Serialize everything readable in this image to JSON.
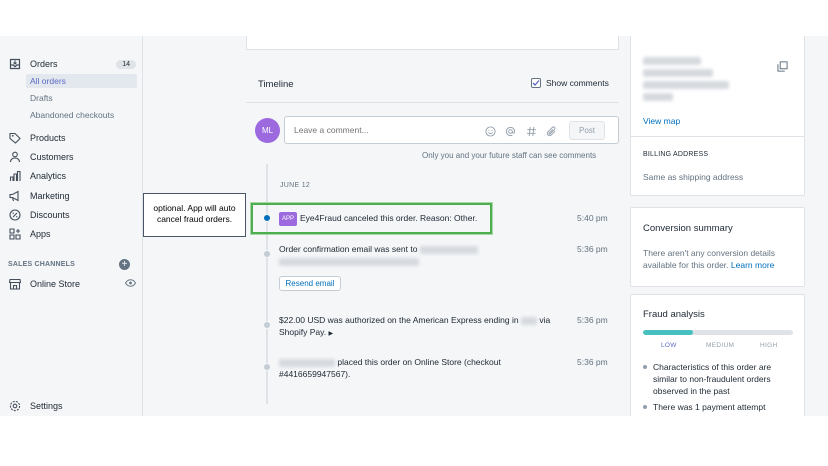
{
  "sidebar": {
    "orders": {
      "label": "Orders",
      "badge": "14",
      "icon": "orders-icon"
    },
    "sub_items": [
      {
        "label": "All orders",
        "active": true
      },
      {
        "label": "Drafts",
        "active": false
      },
      {
        "label": "Abandoned checkouts",
        "active": false
      }
    ],
    "items": [
      {
        "label": "Products",
        "icon": "tag-icon"
      },
      {
        "label": "Customers",
        "icon": "person-icon"
      },
      {
        "label": "Analytics",
        "icon": "bar-chart-icon"
      },
      {
        "label": "Marketing",
        "icon": "megaphone-icon"
      },
      {
        "label": "Discounts",
        "icon": "discount-icon"
      },
      {
        "label": "Apps",
        "icon": "apps-icon"
      }
    ],
    "sales_channels_label": "SALES CHANNELS",
    "online_store": {
      "label": "Online Store",
      "icon": "store-icon"
    },
    "settings": {
      "label": "Settings",
      "icon": "gear-icon"
    }
  },
  "timeline": {
    "title": "Timeline",
    "show_comments_label": "Show comments",
    "show_comments_checked": true,
    "avatar_initials": "ML",
    "comment_placeholder": "Leave a comment...",
    "post_label": "Post",
    "staff_note": "Only you and your future staff can see comments",
    "date_label": "JUNE 12",
    "events": [
      {
        "app_tag": "APP",
        "text": "Eye4Fraud canceled this order. Reason: Other.",
        "time": "5:40 pm"
      },
      {
        "text": "Order confirmation email was sent to",
        "time": "5:36 pm",
        "button": "Resend email"
      },
      {
        "text_a": "$22.00 USD was authorized on the American Express ending in",
        "text_b": "via",
        "text_c": "Shopify Pay.",
        "time": "5:36 pm"
      },
      {
        "text_a": "placed this order on Online Store (checkout",
        "text_b": "#4416659947567).",
        "time": "5:36 pm"
      }
    ]
  },
  "annotation": {
    "line1": "optional. App will auto",
    "line2": "cancel fraud orders."
  },
  "right": {
    "view_map": "View map",
    "billing_title": "BILLING ADDRESS",
    "billing_value": "Same as shipping address",
    "conversion": {
      "title": "Conversion summary",
      "line1": "There aren't any conversion details",
      "line2": "available for this order.",
      "link": "Learn more"
    },
    "fraud": {
      "title": "Fraud analysis",
      "risk_level_fraction": 0.33,
      "labels": [
        "LOW",
        "MEDIUM",
        "HIGH"
      ],
      "bullet1": [
        "Characteristics of this order are",
        "similar to non-fraudulent orders",
        "observed in the past"
      ],
      "bullet2": "There was 1 payment attempt"
    }
  },
  "colors": {
    "accent": "#5c6ac4",
    "link": "#006fbb",
    "app_badge": "#9c6ade",
    "highlight": "#4cae4f",
    "fraud_fill": "#47c1bf"
  }
}
